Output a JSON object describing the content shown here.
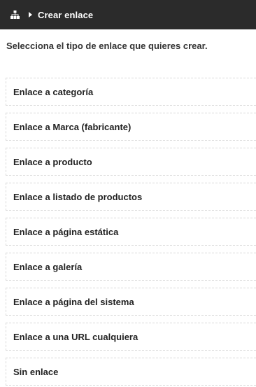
{
  "header": {
    "icon": "sitemap-icon",
    "separator_icon": "caret-right-icon",
    "title": "Crear enlace",
    "background": "#2b2b2b"
  },
  "subtitle": "Selecciona el tipo de enlace que quieres crear.",
  "options": [
    {
      "label": "Enlace a categoría"
    },
    {
      "label": "Enlace a Marca (fabricante)"
    },
    {
      "label": "Enlace a producto"
    },
    {
      "label": "Enlace a listado de productos"
    },
    {
      "label": "Enlace a página estática"
    },
    {
      "label": "Enlace a galería"
    },
    {
      "label": "Enlace a página del sistema"
    },
    {
      "label": "Enlace a una URL cualquiera"
    },
    {
      "label": "Sin enlace"
    }
  ]
}
